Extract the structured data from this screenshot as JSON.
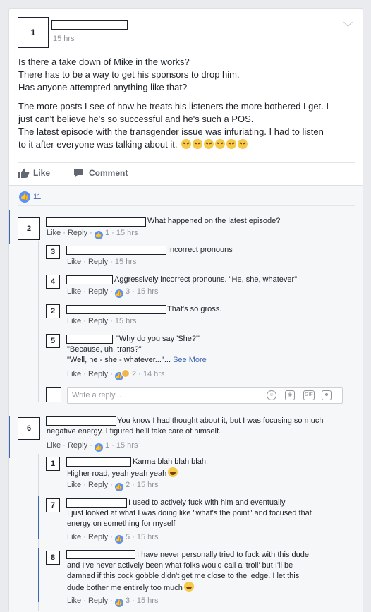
{
  "post": {
    "author_label": "1",
    "timestamp": "15 hrs",
    "paragraph1": [
      "Is there a take down of Mike in the works?",
      "There has to be a way to get his sponsors to drop him.",
      "Has anyone attempted anything like that?"
    ],
    "paragraph2": [
      "The more posts I see of how he treats his listeners the more bothered I get. I",
      "just can't believe he's so successful and he's such a POS.",
      "The latest episode with the transgender issue was infuriating. I had to listen",
      "to it after everyone was talking about it."
    ],
    "like_label": "Like",
    "comment_label": "Comment",
    "reaction_count": "11"
  },
  "ui": {
    "like": "Like",
    "reply": "Reply",
    "sep": "·",
    "see_more": "See More",
    "reply_placeholder": "Write a reply...",
    "gif": "GIF"
  },
  "threads": [
    {
      "comment": {
        "label": "2",
        "text": "What happened on the latest episode?",
        "likes": "1",
        "time": "15 hrs"
      },
      "replies": [
        {
          "label": "3",
          "lines": [
            "Incorrect pronouns"
          ],
          "likes": "",
          "time": "15 hrs"
        },
        {
          "label": "4",
          "lines": [
            "Aggressively incorrect pronouns. \"He, she, whatever\""
          ],
          "likes": "3",
          "time": "15 hrs"
        },
        {
          "label": "2",
          "lines": [
            "That's so gross."
          ],
          "likes": "",
          "time": "15 hrs"
        },
        {
          "label": "5",
          "lines": [
            "\"Why do you say 'She?'\"",
            "\"Because, uh, trans?\"",
            "\"Well, he - she - whatever...\"..."
          ],
          "likes": "2",
          "time": "14 hrs"
        }
      ]
    },
    {
      "comment": {
        "label": "6",
        "text1": "You know I had thought about it, but I was focusing so much",
        "text2": "negative energy. I figured he'll take care of himself.",
        "likes": "1",
        "time": "15 hrs"
      },
      "replies": [
        {
          "label": "1",
          "lines": [
            "Karma blah blah blah.",
            "Higher road, yeah yeah yeah"
          ],
          "likes": "2",
          "time": "15 hrs"
        },
        {
          "label": "7",
          "lines": [
            "I used to actively fuck with him and eventually",
            "I just looked at what I was doing like \"what's the point\" and focused that",
            "energy on something for myself"
          ],
          "likes": "5",
          "time": "15 hrs"
        },
        {
          "label": "8",
          "lines": [
            "I have never personally tried to fuck with this dude",
            "and I've never actively been what folks would call a 'troll' but I'll be",
            "damned if this cock gobble didn't get me close to the ledge. I let this",
            "dude bother me entirely too much"
          ],
          "likes": "3",
          "time": "15 hrs"
        }
      ]
    }
  ]
}
